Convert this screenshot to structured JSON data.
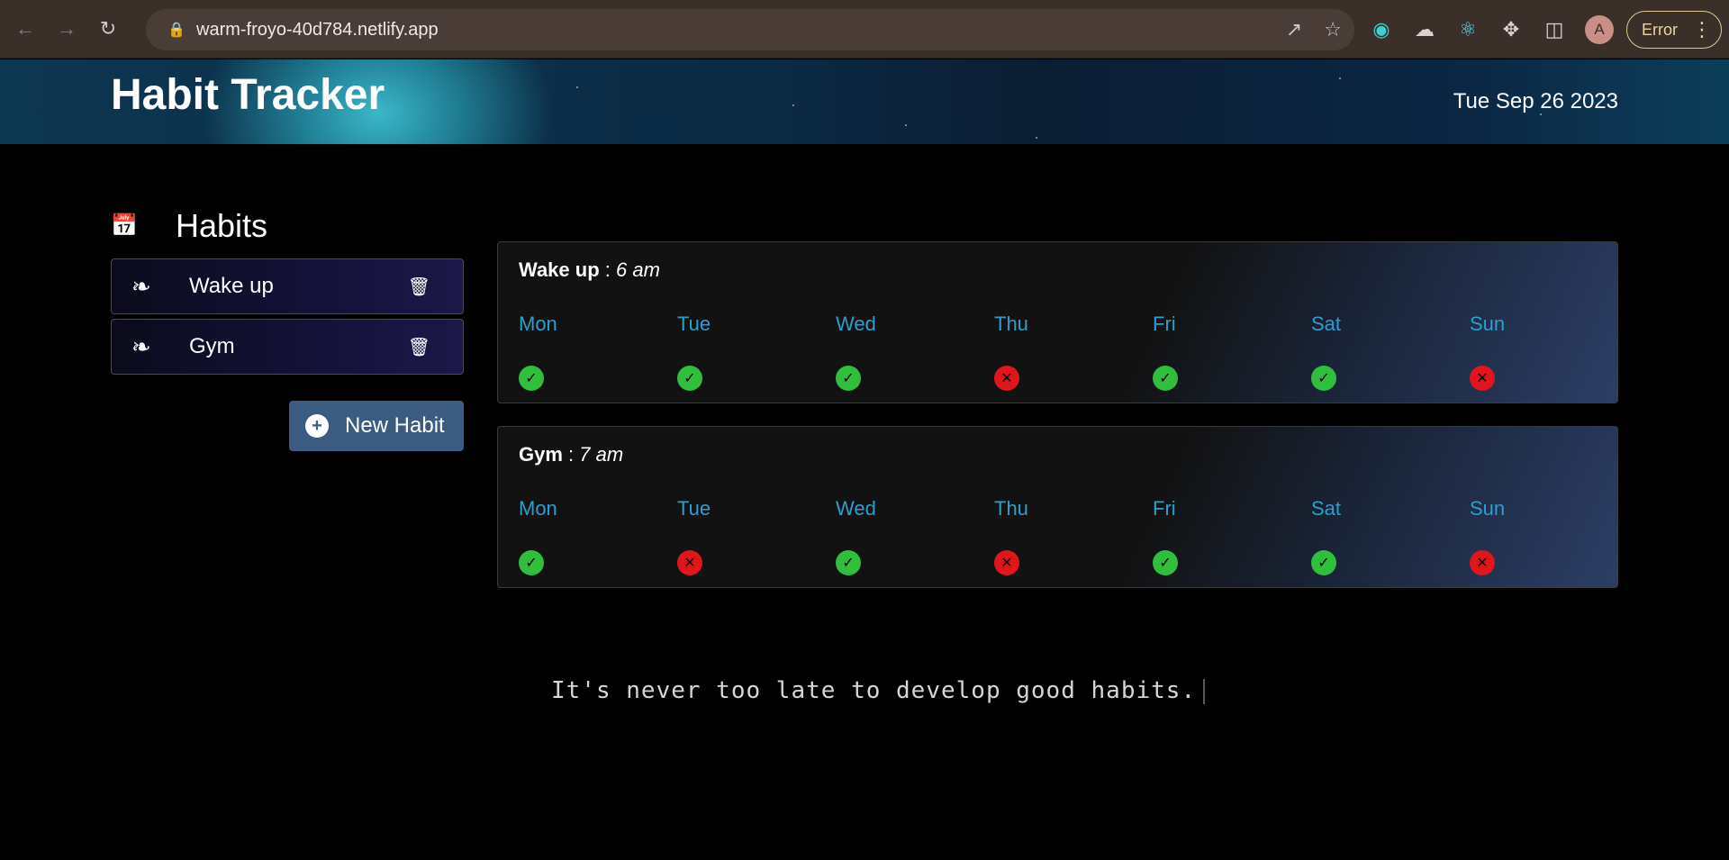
{
  "browser": {
    "url": "warm-froyo-40d784.netlify.app",
    "profile_initial": "A",
    "error_label": "Error"
  },
  "header": {
    "title": "Habit Tracker",
    "date": "Tue Sep 26 2023"
  },
  "sidebar": {
    "heading": "Habits",
    "items": [
      {
        "name": "Wake up"
      },
      {
        "name": "Gym"
      }
    ],
    "new_habit_label": "New Habit"
  },
  "cards": [
    {
      "name": "Wake up",
      "time": "6 am",
      "days": [
        "Mon",
        "Tue",
        "Wed",
        "Thu",
        "Fri",
        "Sat",
        "Sun"
      ],
      "status": [
        "done",
        "done",
        "done",
        "missed",
        "done",
        "done",
        "missed"
      ]
    },
    {
      "name": "Gym",
      "time": "7 am",
      "days": [
        "Mon",
        "Tue",
        "Wed",
        "Thu",
        "Fri",
        "Sat",
        "Sun"
      ],
      "status": [
        "done",
        "missed",
        "done",
        "missed",
        "done",
        "done",
        "missed"
      ]
    }
  ],
  "quote": "It's never too late to develop good habits.",
  "colors": {
    "day_label": "#2a9fd0",
    "done": "#2fbf3d",
    "missed": "#e0161c",
    "button": "#3b5b80"
  }
}
